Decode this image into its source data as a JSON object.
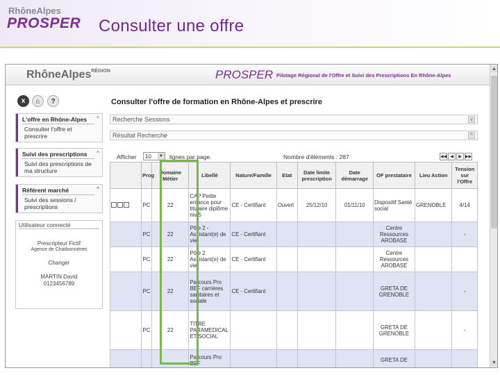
{
  "slide": {
    "logo_top": "RhôneAlpes",
    "logo_bottom": "PROSPER",
    "title": "Consulter une offre"
  },
  "banner": {
    "logo": "RhôneAlpes",
    "logo_small": "RÉGION",
    "prosper": "PROSPER",
    "subtitle": "Pilotage Régional de l'Offre et Suivi des Prescriptions En Rhône-Alpes"
  },
  "sidebar": {
    "icons": [
      "close-icon",
      "home-icon",
      "help-icon"
    ],
    "close_label": "x",
    "home_label": "⌂",
    "help_label": "?",
    "sections": [
      {
        "head": "L'offre en Rhône-Alpes",
        "links": [
          "Consulter l'offre et",
          "prescrire"
        ]
      },
      {
        "head": "Suivi des prescriptions",
        "links": [
          "Suivi des prescriptions de",
          "ma structure"
        ]
      },
      {
        "head": "Référent marché",
        "links": [
          "Suivi des sessions /",
          "prescriptions"
        ]
      }
    ],
    "user": {
      "head": "Utilisateur connecté",
      "role": "Prescripteur Fictif",
      "agency": "Agence de Charbonnières",
      "change": "Changer",
      "name": "MARTIN David",
      "phone": "0123456789"
    }
  },
  "main": {
    "title": "Consulter l'offre de formation en Rhône-Alpes et prescrire",
    "search_sessions": "Recherche Sessions",
    "search_result": "Résultat Recherche",
    "show_label": "Afficher",
    "per_page_value": "10",
    "per_page_label": "lignes par page.",
    "count_label": "Nombre d'éléments : 287",
    "pager": [
      "◀◀",
      "◀",
      "▶",
      "▶▶"
    ],
    "columns": [
      "",
      "Prog",
      "Domaine Métier",
      "Libellé",
      "Nature/Famille",
      "Etat",
      "Date limite prescription",
      "Date démarrage",
      "OF prestataire",
      "Lieu Action",
      "Tension sur l'Offre"
    ],
    "rows": [
      {
        "prog": "PC",
        "dom": "22",
        "lib": "CAP Petite enfance pour titulaire diplôme niv 5",
        "nat": "CE - Certifiant",
        "etat": "Ouvert",
        "dlp": "25/12/10",
        "dd": "01/11/10",
        "of": "Dispositif Santé social",
        "lieu": "GRENOBLE",
        "tension": "4/14"
      },
      {
        "prog": "PC",
        "dom": "22",
        "lib": "Pôle 2 - Assistant(e) de vie",
        "nat": "CE - Certifiant",
        "etat": "",
        "dlp": "",
        "dd": "",
        "of": "Centre Ressources AROBASE",
        "lieu": "",
        "tension": "-"
      },
      {
        "prog": "PC",
        "dom": "22",
        "lib": "Pôle 2 Assistant(e) de vie",
        "nat": "CE - Certifiant",
        "etat": "",
        "dlp": "",
        "dd": "",
        "of": "Centre Ressources AROBASE",
        "lieu": "",
        "tension": ""
      },
      {
        "prog": "PC",
        "dom": "22",
        "lib": "Parcours Pro BEF carrières sanitaires et sociale",
        "nat": "CE - Certifiant",
        "etat": "",
        "dlp": "",
        "dd": "",
        "of": "GRETA DE GRENOBLE",
        "lieu": "",
        "tension": "-"
      },
      {
        "prog": "PC",
        "dom": "22",
        "lib": "TITRE PARAMEDICAL ET SOCIAL",
        "nat": "",
        "etat": "",
        "dlp": "",
        "dd": "",
        "of": "GRETA DE GRENOBLE",
        "lieu": "",
        "tension": "-"
      },
      {
        "prog": "",
        "dom": "",
        "lib": "Parcours Pro BEF",
        "nat": "",
        "etat": "",
        "dlp": "",
        "dd": "",
        "of": "GRETA DE",
        "lieu": "",
        "tension": ""
      }
    ]
  }
}
